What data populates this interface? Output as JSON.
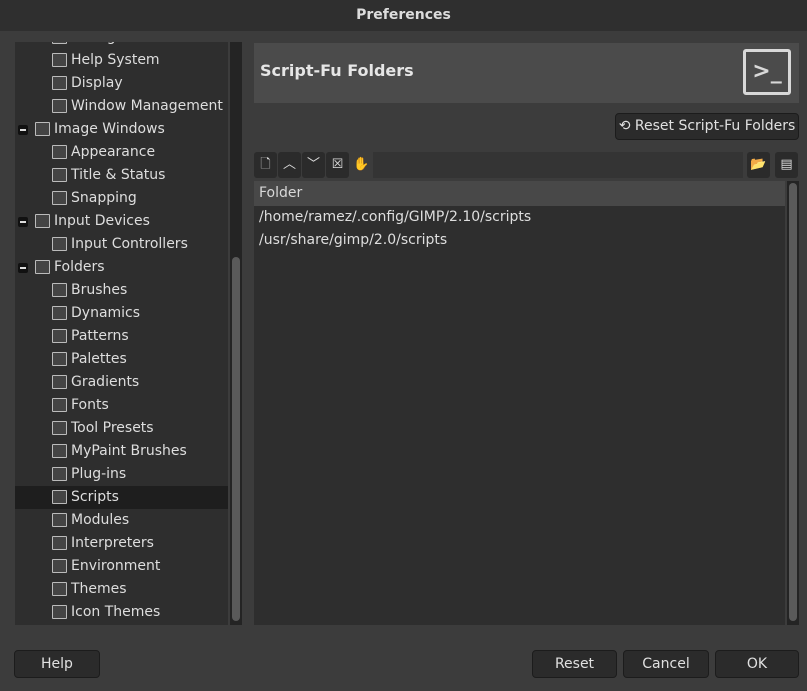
{
  "window": {
    "title": "Preferences"
  },
  "tree": [
    {
      "label": "Dialog Defaults",
      "level": 1
    },
    {
      "label": "Help System",
      "level": 1
    },
    {
      "label": "Display",
      "level": 1
    },
    {
      "label": "Window Management",
      "level": 1
    },
    {
      "label": "Image Windows",
      "level": 0
    },
    {
      "label": "Appearance",
      "level": 1
    },
    {
      "label": "Title & Status",
      "level": 1
    },
    {
      "label": "Snapping",
      "level": 1
    },
    {
      "label": "Input Devices",
      "level": 0
    },
    {
      "label": "Input Controllers",
      "level": 1
    },
    {
      "label": "Folders",
      "level": 0
    },
    {
      "label": "Brushes",
      "level": 1
    },
    {
      "label": "Dynamics",
      "level": 1
    },
    {
      "label": "Patterns",
      "level": 1
    },
    {
      "label": "Palettes",
      "level": 1
    },
    {
      "label": "Gradients",
      "level": 1
    },
    {
      "label": "Fonts",
      "level": 1
    },
    {
      "label": "Tool Presets",
      "level": 1
    },
    {
      "label": "MyPaint Brushes",
      "level": 1
    },
    {
      "label": "Plug-ins",
      "level": 1
    },
    {
      "label": "Scripts",
      "level": 1,
      "selected": true
    },
    {
      "label": "Modules",
      "level": 1
    },
    {
      "label": "Interpreters",
      "level": 1
    },
    {
      "label": "Environment",
      "level": 1
    },
    {
      "label": "Themes",
      "level": 1
    },
    {
      "label": "Icon Themes",
      "level": 1
    }
  ],
  "panel": {
    "title": "Script-Fu Folders",
    "reset_label": "Reset Script-Fu Folders",
    "column_header": "Folder",
    "folders": [
      "/home/ramez/.config/GIMP/2.10/scripts",
      "/usr/share/gimp/2.0/scripts"
    ]
  },
  "buttons": {
    "help": "Help",
    "reset": "Reset",
    "cancel": "Cancel",
    "ok": "OK"
  }
}
